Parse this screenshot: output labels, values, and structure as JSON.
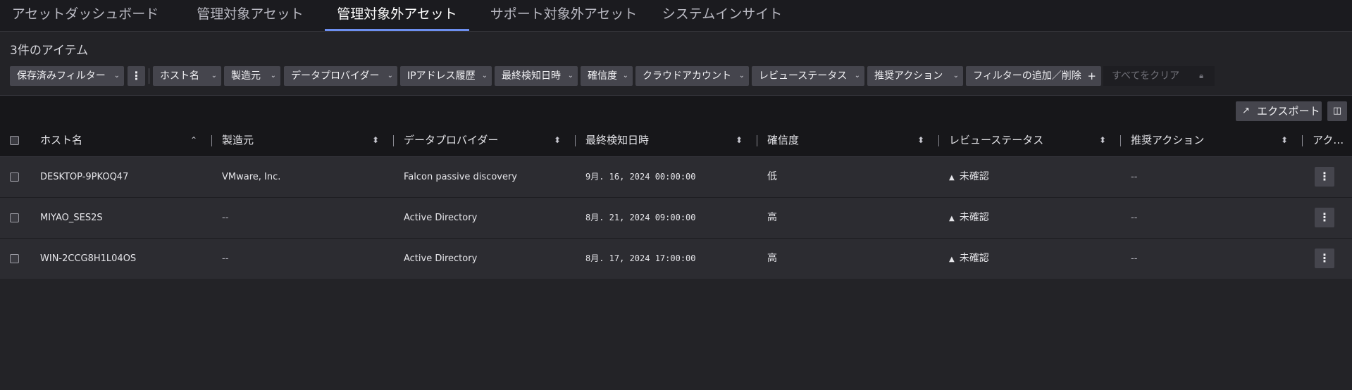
{
  "tabs": [
    {
      "label": "アセットダッシュボード",
      "active": false
    },
    {
      "label": "管理対象アセット",
      "active": false
    },
    {
      "label": "管理対象外アセット",
      "active": true
    },
    {
      "label": "サポート対象外アセット",
      "active": false
    },
    {
      "label": "システムインサイト",
      "active": false
    }
  ],
  "item_count": "3件のアイテム",
  "filters": {
    "saved_filters": "保存済みフィルター",
    "more_icon": "vertical-dots-icon",
    "chips": [
      "ホスト名",
      "製造元",
      "データプロバイダー",
      "IPアドレス履歴",
      "最終検知日時",
      "確信度",
      "クラウドアカウント",
      "レビューステータス",
      "推奨アクション"
    ],
    "add_remove": "フィルターの追加／削除",
    "add_symbol": "+",
    "clear_all": "すべてをクリア"
  },
  "toolbar": {
    "export_label": "エクスポート",
    "export_icon": "external-link-icon",
    "columns_icon": "column-settings-icon"
  },
  "table": {
    "columns": [
      "ホスト名",
      "製造元",
      "データプロバイダー",
      "最終検知日時",
      "確信度",
      "レビューステータス",
      "推奨アクション",
      "アク…"
    ],
    "rows": [
      {
        "host": "DESKTOP-9PKOQ47",
        "vendor": "VMware, Inc.",
        "provider": "Falcon passive discovery",
        "last_seen": "9月. 16, 2024 00:00:00",
        "confidence": "低",
        "status": "未確認",
        "action": "--"
      },
      {
        "host": "MIYAO_SES2S",
        "vendor": "--",
        "provider": "Active Directory",
        "last_seen": "8月. 21, 2024 09:00:00",
        "confidence": "高",
        "status": "未確認",
        "action": "--"
      },
      {
        "host": "WIN-2CCG8H1L04OS",
        "vendor": "--",
        "provider": "Active Directory",
        "last_seen": "8月. 17, 2024 17:00:00",
        "confidence": "高",
        "status": "未確認",
        "action": "--"
      }
    ]
  },
  "colors": {
    "accent": "#6d8ff0",
    "background": "#232327",
    "chip": "#45454d"
  }
}
